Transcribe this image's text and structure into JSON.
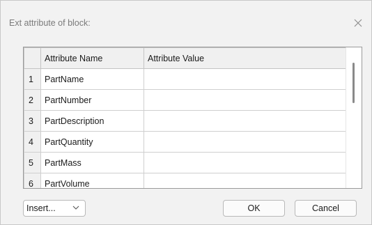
{
  "dialog": {
    "title": "Ext attribute of block:",
    "close_glyph": "✕"
  },
  "grid": {
    "columns": [
      "",
      "Attribute Name",
      "Attribute Value"
    ],
    "rows": [
      {
        "num": "1",
        "name": "PartName",
        "value": ""
      },
      {
        "num": "2",
        "name": "PartNumber",
        "value": ""
      },
      {
        "num": "3",
        "name": "PartDescription",
        "value": ""
      },
      {
        "num": "4",
        "name": "PartQuantity",
        "value": ""
      },
      {
        "num": "5",
        "name": "PartMass",
        "value": ""
      },
      {
        "num": "6",
        "name": "PartVolume",
        "value": ""
      }
    ]
  },
  "footer": {
    "insert_label": "Insert...",
    "ok_label": "OK",
    "cancel_label": "Cancel"
  },
  "icons": {
    "close": "close-icon",
    "chevron": "chevron-down-icon"
  }
}
